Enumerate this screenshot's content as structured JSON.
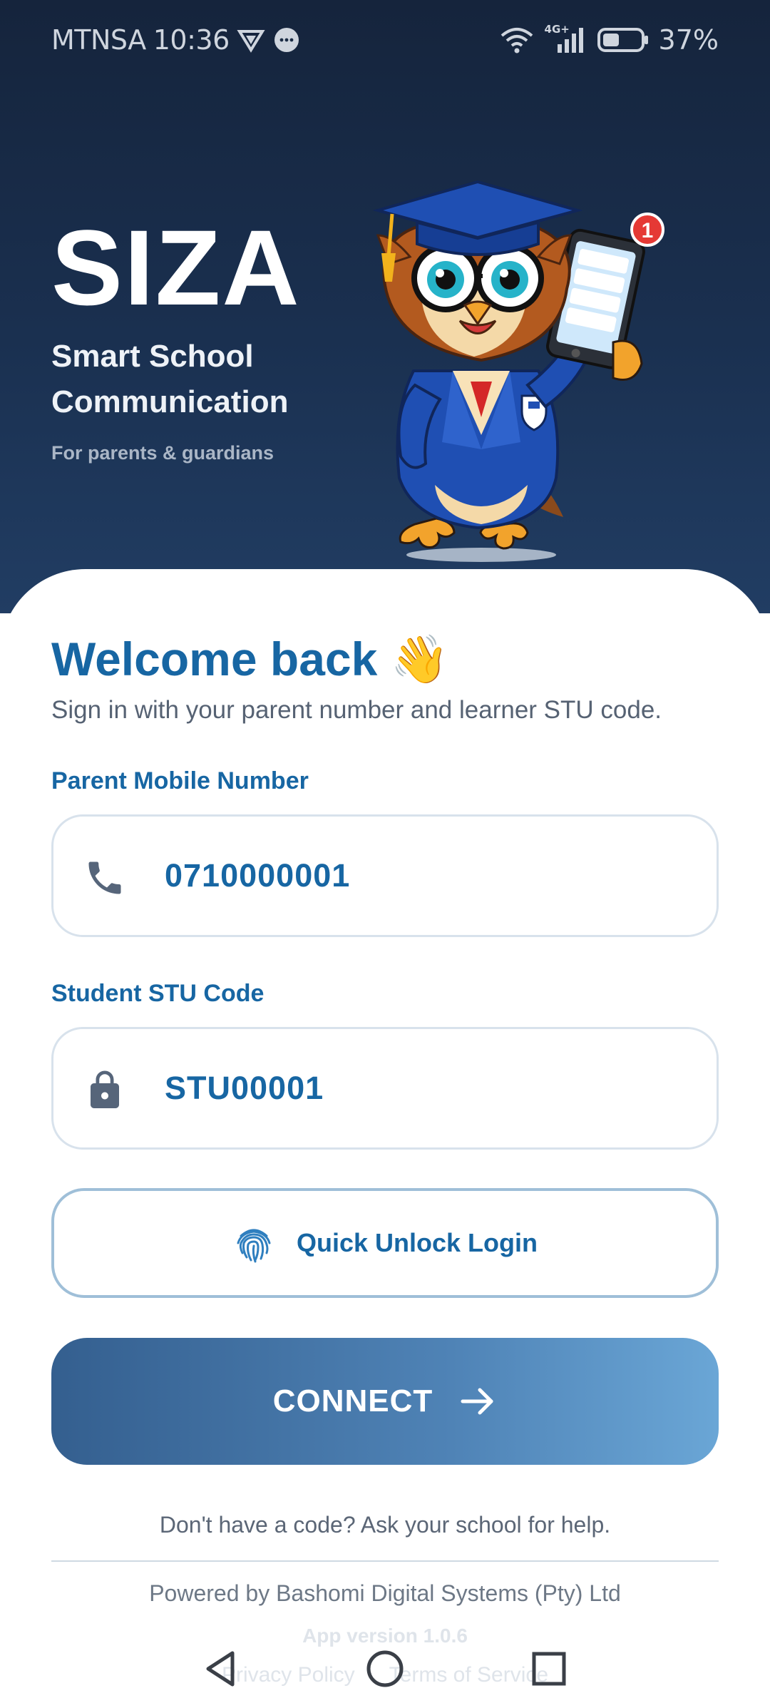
{
  "status_bar": {
    "carrier": "MTNSA",
    "time": "10:36",
    "battery": "37%",
    "network_label": "4G+",
    "icons": [
      "vpn-icon",
      "message-icon",
      "wifi-icon",
      "signal-icon",
      "battery-icon"
    ]
  },
  "hero": {
    "title": "SIZA",
    "subtitle": "Smart School Communication",
    "tagline": "For parents & guardians",
    "mascot_badge": "1",
    "colors": {
      "background": "#1a3050"
    }
  },
  "login": {
    "welcome_title": "Welcome back 👋",
    "welcome_subtitle": "Sign in with your parent number and learner STU code.",
    "mobile_label": "Parent Mobile Number",
    "mobile_value": "0710000001",
    "stu_label": "Student STU Code",
    "stu_value": "STU00001",
    "quick_unlock_label": "Quick Unlock Login",
    "connect_label": "CONNECT",
    "help_text": "Don't have a code? Ask your school for help.",
    "powered_by": "Powered by Bashomi Digital Systems (Pty) Ltd",
    "app_version": "App version 1.0.6",
    "privacy_link": "Privacy Policy",
    "terms_link": "Terms of Service",
    "colors": {
      "accent": "#1766a3",
      "connect_start": "#345f8f",
      "connect_end": "#6aa6d6"
    }
  },
  "nav": {
    "buttons": [
      "back-icon",
      "home-icon",
      "recents-icon"
    ]
  }
}
